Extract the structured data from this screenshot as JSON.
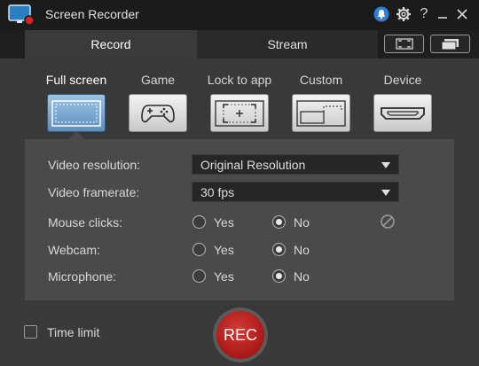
{
  "app": {
    "title": "Screen Recorder"
  },
  "titlebar_icons": [
    "notification-bell-icon",
    "gear-icon",
    "help-icon",
    "minimize-icon",
    "close-icon"
  ],
  "tabs": [
    {
      "label": "Record",
      "active": true
    },
    {
      "label": "Stream",
      "active": false
    }
  ],
  "view_buttons": [
    "fullscreen-view-icon",
    "compact-view-icon"
  ],
  "modes": [
    {
      "label": "Full screen",
      "icon": "fullscreen-capture-icon",
      "active": true
    },
    {
      "label": "Game",
      "icon": "gamepad-icon",
      "active": false
    },
    {
      "label": "Lock to app",
      "icon": "lock-to-app-icon",
      "active": false
    },
    {
      "label": "Custom",
      "icon": "custom-region-icon",
      "active": false
    },
    {
      "label": "Device",
      "icon": "hdmi-device-icon",
      "active": false
    }
  ],
  "settings": {
    "video_resolution": {
      "label": "Video resolution:",
      "value": "Original Resolution"
    },
    "video_framerate": {
      "label": "Video framerate:",
      "value": "30 fps"
    },
    "mouse_clicks": {
      "label": "Mouse clicks:",
      "yes": "Yes",
      "no": "No",
      "selected": "No"
    },
    "webcam": {
      "label": "Webcam:",
      "yes": "Yes",
      "no": "No",
      "selected": "No"
    },
    "microphone": {
      "label": "Microphone:",
      "yes": "Yes",
      "no": "No",
      "selected": "No"
    }
  },
  "footer": {
    "time_limit_label": "Time limit",
    "time_limit_checked": false,
    "rec_label": "REC"
  },
  "colors": {
    "accent_active_mode": "#7aa7d1",
    "rec_red": "#b81f1c"
  }
}
